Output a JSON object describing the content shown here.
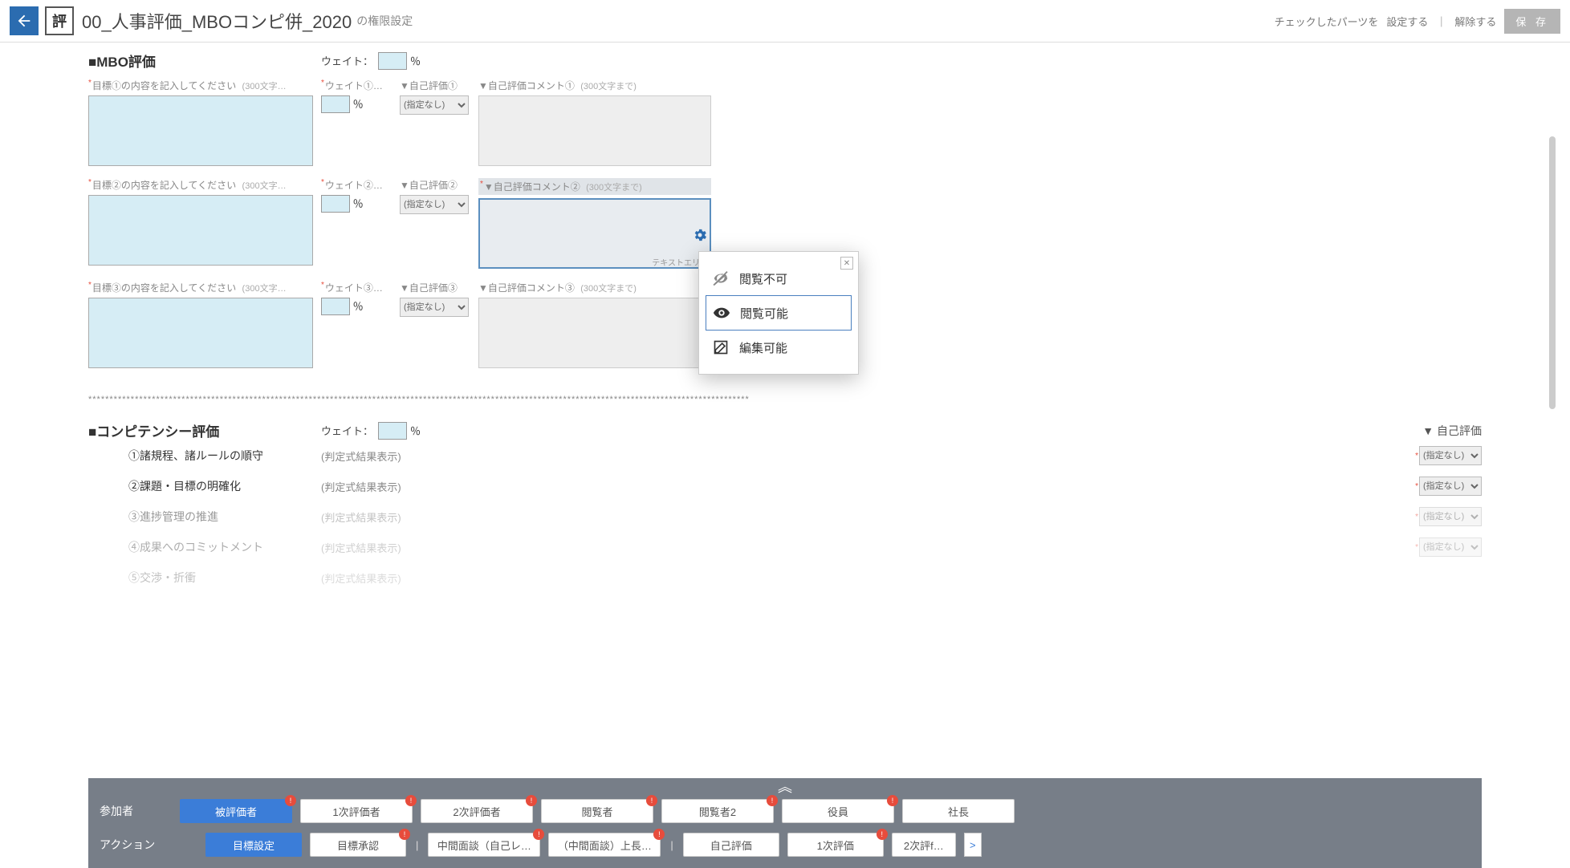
{
  "header": {
    "eval_badge": "評",
    "title": "00_人事評価_MBOコンピ併_2020",
    "subtitle": "の権限設定",
    "checked_text": "チェックしたパーツを",
    "set_link": "設定する",
    "sep": "｜",
    "unset_link": "解除する",
    "save": "保 存"
  },
  "mbo": {
    "title": "■MBO評価",
    "weight_label": "ウェイト：",
    "pct": "％",
    "rows": [
      {
        "goal_label": "目標①の内容を記入してください",
        "goal_hint": "(300文字…",
        "weight_label": "ウェイト①…",
        "selfeval_label": "▼自己評価①",
        "comment_label": "▼自己評価コメント①",
        "comment_hint": "(300文字まで)"
      },
      {
        "goal_label": "目標②の内容を記入してください",
        "goal_hint": "(300文字…",
        "weight_label": "ウェイト②…",
        "selfeval_label": "▼自己評価②",
        "comment_label": "▼自己評価コメント②",
        "comment_hint": "(300文字まで)"
      },
      {
        "goal_label": "目標③の内容を記入してください",
        "goal_hint": "(300文字…",
        "weight_label": "ウェイト③…",
        "selfeval_label": "▼自己評価③",
        "comment_label": "▼自己評価コメント③",
        "comment_hint": "(300文字まで)"
      }
    ],
    "select_default": "(指定なし)",
    "textarea_hint": "テキストエリ…"
  },
  "comp": {
    "title": "■コンピテンシー評価",
    "weight_label": "ウェイト：",
    "pct": "％",
    "selfeval_header": "▼ 自己評価",
    "items": [
      {
        "name": "①諸規程、諸ルールの順守",
        "result": "(判定式結果表示)"
      },
      {
        "name": "②課題・目標の明確化",
        "result": "(判定式結果表示)"
      },
      {
        "name": "③進捗管理の推進",
        "result": "(判定式結果表示)"
      },
      {
        "name": "④成果へのコミットメント",
        "result": "(判定式結果表示)"
      },
      {
        "name": "⑤交渉・折衝",
        "result": "(判定式結果表示)"
      }
    ],
    "select_default": "(指定なし)"
  },
  "popup": {
    "opt_noview": "閲覧不可",
    "opt_view": "閲覧可能",
    "opt_edit": "編集可能"
  },
  "panel": {
    "participants_label": "参加者",
    "actions_label": "アクション",
    "participants": [
      "被評価者",
      "1次評価者",
      "2次評価者",
      "閲覧者",
      "閲覧者2",
      "役員",
      "社長"
    ],
    "actions": [
      "目標設定",
      "目標承認",
      "中間面談（自己レ…",
      "（中間面談）上長…",
      "自己評価",
      "1次評価",
      "2次評f…"
    ],
    "badge": "!",
    "arrow": ">"
  }
}
